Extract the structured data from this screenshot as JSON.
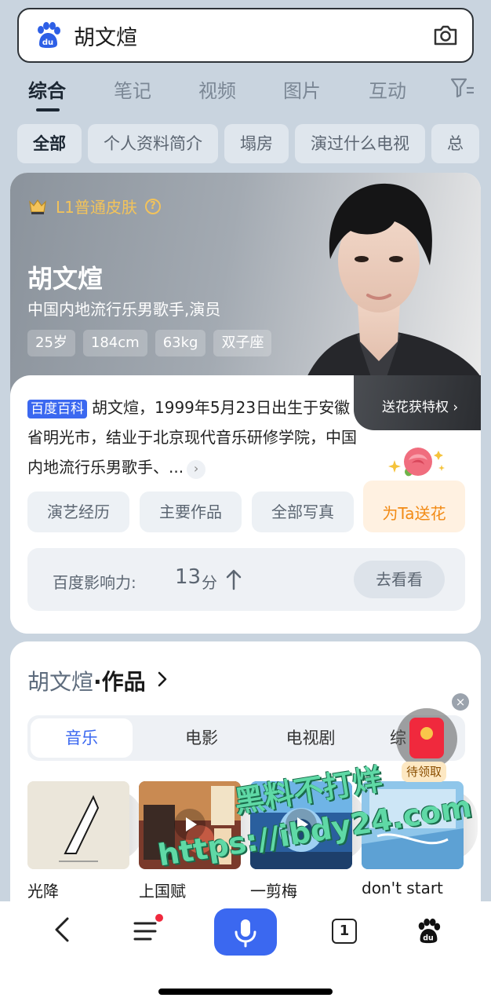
{
  "search": {
    "query": "胡文煊"
  },
  "tabs": [
    "综合",
    "笔记",
    "视频",
    "图片",
    "互动"
  ],
  "chips": [
    "全部",
    "个人资料简介",
    "塌房",
    "演过什么电视",
    "总"
  ],
  "profile": {
    "skin_badge": "L1普通皮肤",
    "help": "?",
    "name": "胡文煊",
    "subtitle": "中国内地流行乐男歌手,演员",
    "stats": [
      "25岁",
      "184cm",
      "63kg",
      "双子座"
    ],
    "flower_privilege": "送花获特权 ›",
    "baike_badge": "百度百科",
    "baike_text": "胡文煊，1999年5月23日出生于安徽省明光市，结业于北京现代音乐研修学院，中国内地流行乐男歌手、...",
    "more_arrow": "›",
    "actions": [
      "演艺经历",
      "主要作品",
      "全部写真"
    ],
    "send_flower": "为Ta送花",
    "influence_label": "百度影响力:",
    "influence_score": "13",
    "influence_unit": "分",
    "go_see": "去看看"
  },
  "works": {
    "name": "胡文煊",
    "label": "·作品",
    "tabs": [
      "音乐",
      "电影",
      "电视剧",
      "综"
    ],
    "albums": [
      "光降",
      "上国赋",
      "一剪梅",
      "don't start"
    ]
  },
  "redpacket": {
    "close": "×",
    "label": "待领取"
  },
  "watermark": {
    "line1": "黑料不打烊",
    "line2": "https://ibdy24.com"
  },
  "bottom_nav": {
    "tab_count": "1"
  },
  "colors": {
    "accent": "#3b68f0",
    "page_bg": "#c9d4df",
    "orange": "#f28a14",
    "gold": "#f3c35a"
  }
}
